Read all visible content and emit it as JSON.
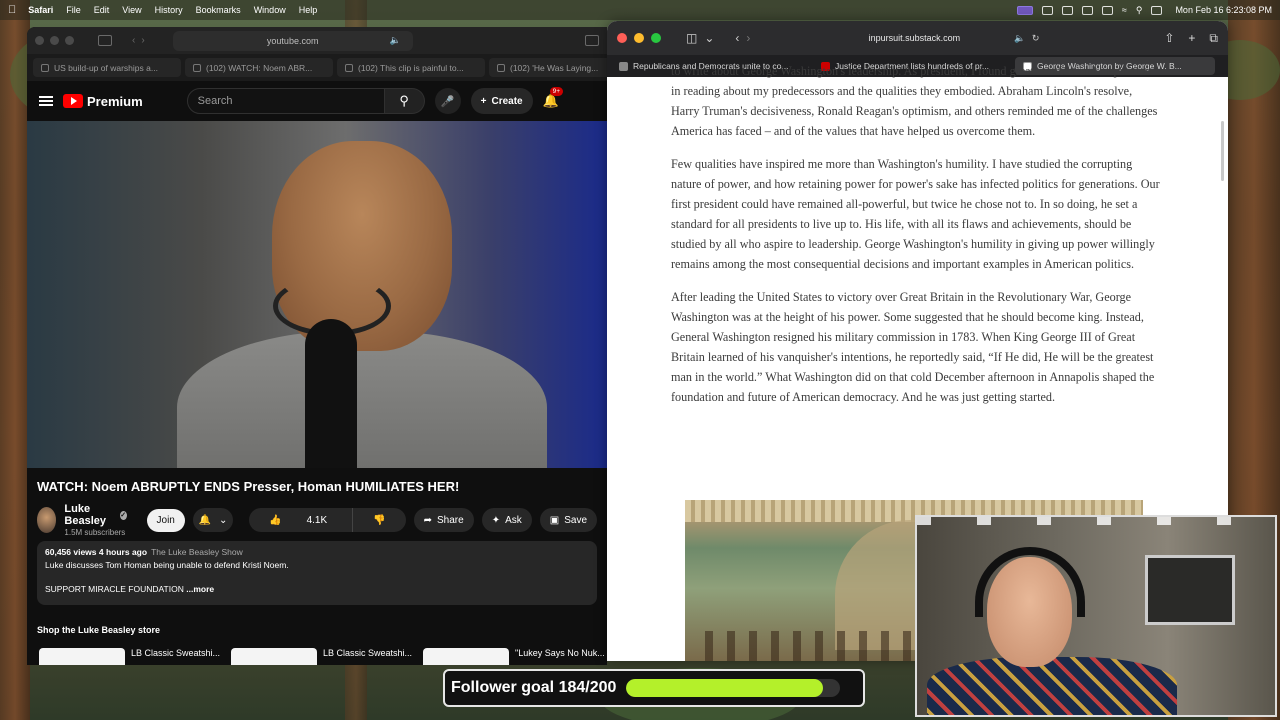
{
  "menubar": {
    "app": "Safari",
    "menus": [
      "File",
      "Edit",
      "View",
      "History",
      "Bookmarks",
      "Window",
      "Help"
    ],
    "clock": "Mon Feb 16  6:23:08 PM"
  },
  "left_window": {
    "url": "youtube.com",
    "tabs": [
      "US build-up of warships a...",
      "(102) WATCH: Noem ABR...",
      "(102) This clip is painful to...",
      "(102) 'He Was Laying..."
    ],
    "youtube": {
      "brand": "Premium",
      "search_placeholder": "Search",
      "create_label": "Create",
      "notif_badge": "9+",
      "video_title": "WATCH: Noem ABRUPTLY ENDS Presser, Homan HUMILIATES HER!",
      "channel_name": "Luke Beasley",
      "subscribers": "1.5M subscribers",
      "join_label": "Join",
      "likes": "4.1K",
      "share_label": "Share",
      "ask_label": "Ask",
      "save_label": "Save",
      "description": {
        "views_time": "60,456 views  4 hours ago",
        "channel_tag": "The Luke Beasley Show",
        "line1": "Luke discusses Tom Homan being unable to defend Kristi Noem.",
        "line2": "SUPPORT MIRACLE FOUNDATION",
        "more": "...more"
      },
      "store_title": "Shop the Luke Beasley store",
      "store_items": [
        "LB Classic Sweatshi...",
        "LB Classic Sweatshi...",
        "\"Lukey Says No Nuk..."
      ]
    }
  },
  "right_window": {
    "url": "inpursuit.substack.com",
    "tabs": [
      "Republicans and Democrats unite to co...",
      "Justice Department lists hundreds of pr...",
      "George Washington by George W. B..."
    ],
    "article": {
      "p0": "to write about George Washington's leadership. As president, I found great comfort and inspiration in reading about my predecessors and the qualities they embodied. Abraham Lincoln's resolve, Harry Truman's decisiveness, Ronald Reagan's optimism, and others reminded me of the challenges America has faced – and of the values that have helped us overcome them.",
      "p1": "Few qualities have inspired me more than Washington's humility. I have studied the corrupting nature of power, and how retaining power for power's sake has infected politics for generations. Our first president could have remained all-powerful, but twice he chose not to. In so doing, he set a standard for all presidents to live up to. His life, with all its flaws and achievements, should be studied by all who aspire to leadership. George Washington's humility in giving up power willingly remains among the most consequential decisions and important examples in American politics.",
      "p2": "After leading the United States to victory over Great Britain in the Revolutionary War, George Washington was at the height of his power. Some suggested that he should become king. Instead, General Washington resigned his military commission in 1783. When King George III of Great Britain learned of his vanquisher's intentions, he reportedly said, “If He did, He will be the greatest man in the world.” What Washington did on that cold December afternoon in Annapolis shaped the foundation and future of American democracy. And he was just getting started."
    }
  },
  "follower_goal": {
    "label": "Follower goal 184/200",
    "current": 184,
    "target": 200,
    "progress": 0.92,
    "color": "#b4f02a"
  }
}
